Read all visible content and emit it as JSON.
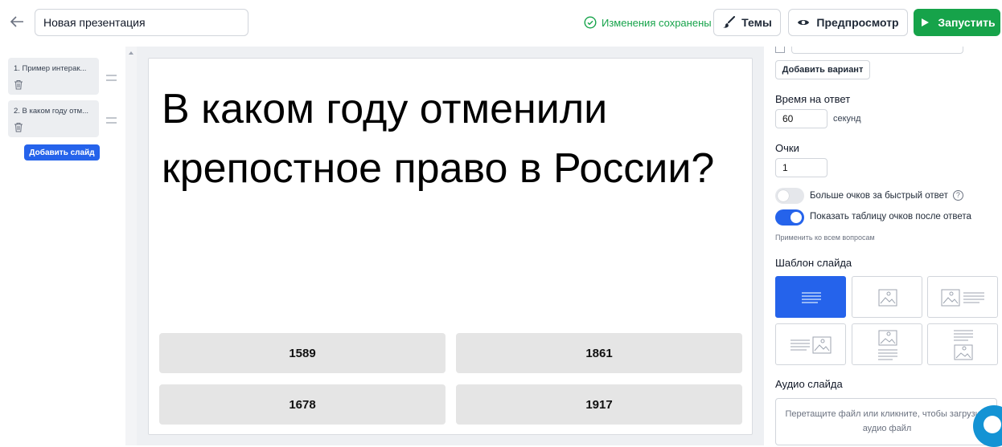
{
  "header": {
    "back_icon": "arrow-left-icon",
    "title_value": "Новая презентация",
    "saved_status": "Изменения сохранены",
    "themes_label": "Темы",
    "preview_label": "Предпросмотр",
    "launch_label": "Запустить",
    "colors": {
      "saved": "#16a34a",
      "launch": "#16a34a",
      "accent": "#2563eb"
    }
  },
  "slides": {
    "items": [
      {
        "label": "1. Пример интерак..."
      },
      {
        "label": "2. В каком году отм..."
      }
    ],
    "add_label": "Добавить слайд"
  },
  "slide": {
    "question": "В каком году отменили крепостное право в России?",
    "answers": [
      "1589",
      "1861",
      "1678",
      "1917"
    ]
  },
  "panel": {
    "add_variant": "Добавить вариант",
    "time_label": "Время на ответ",
    "time_value": "60",
    "time_unit": "секунд",
    "points_label": "Очки",
    "points_value": "1",
    "fast_answer_label": "Больше очков за быстрый ответ",
    "fast_answer_on": false,
    "show_scores_label": "Показать таблицу очков после ответа",
    "show_scores_on": true,
    "apply_all": "Применить ко всем вопросам",
    "template_label": "Шаблон слайда",
    "templates": [
      "text-only",
      "image-only",
      "image-left-text-right",
      "text-left-image-right",
      "image-top-text-bottom",
      "text-top-image-bottom"
    ],
    "active_template": "text-only",
    "audio_label": "Аудио слайда",
    "audio_drop": "Перетащите файл или кликните, чтобы загрузить аудио файл"
  }
}
